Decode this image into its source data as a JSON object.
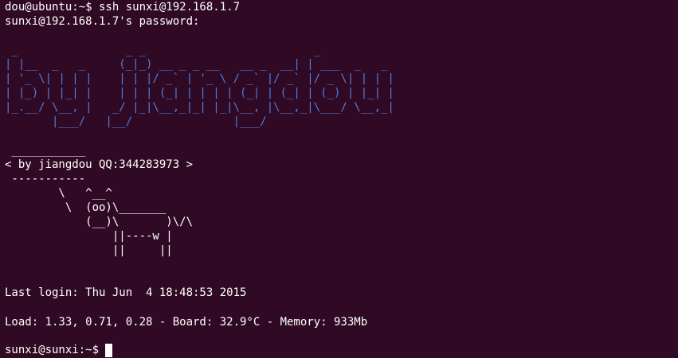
{
  "terminal": {
    "line_ssh_command": "dou@ubuntu:~$ ssh sunxi@192.168.1.7",
    "line_password_prompt": "sunxi@192.168.1.7's password:",
    "banner_ascii": " _                _ _                         _             \n| |__  _   _     (_|_) __ _ _ __   __ _  __| | ___  _   _ \n| '_ \\| | | |    | | |/ _` | '_ \\ / _` |/ _` |/ _ \\| | | |\n| |_) | |_| |    | | | (_| | | | | (_| | (_| | (_) | |_| |\n|_.__/ \\__, |   _/ |_|\\__,_|_| |_|\\__, |\\__,_|\\___/ \\__,_|\n       |___/   |__/               |___/                  ",
    "cow_ascii": " ___________\n< by jiangdou QQ:344283973 >\n -----------\n        \\   ^__^\n         \\  (oo)\\_______\n            (__)\\       )\\/\\\n                ||----w |\n                ||     ||",
    "last_login": "Last login: Thu Jun  4 18:48:53 2015",
    "load_info": "Load: 1.33, 0.71, 0.28 - Board: 32.9°C - Memory: 933Mb",
    "prompt": "sunxi@sunxi:~$"
  },
  "colors": {
    "background": "#300a24",
    "text": "#ffffff",
    "banner": "#4f7ee0"
  }
}
